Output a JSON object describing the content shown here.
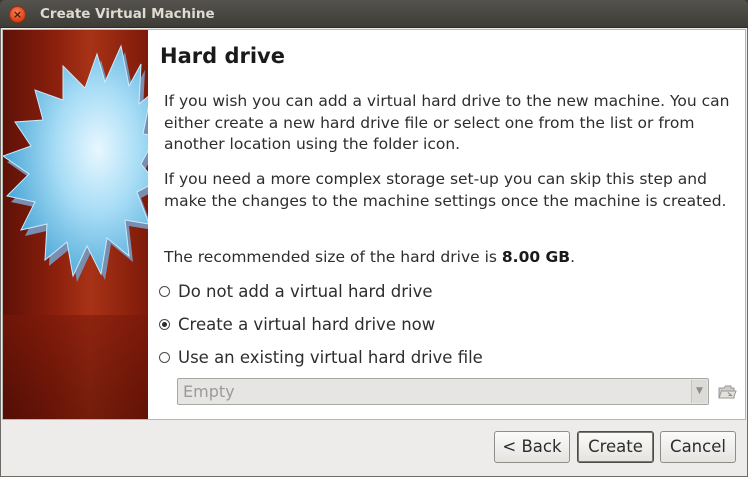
{
  "window": {
    "title": "Create Virtual Machine",
    "close_icon": "close-icon"
  },
  "page": {
    "heading": "Hard drive",
    "paragraph1": "If you wish you can add a virtual hard drive to the new machine. You can either create a new hard drive file or select one from the list or from another location using the folder icon.",
    "paragraph2": "If you need a more complex storage set-up you can skip this step and make the changes to the machine settings once the machine is created.",
    "recommended_prefix": "The recommended size of the hard drive is ",
    "recommended_size": "8.00 GB",
    "recommended_suffix": "."
  },
  "options": [
    {
      "label": "Do not add a virtual hard drive",
      "checked": false
    },
    {
      "label": "Create a virtual hard drive now",
      "checked": true
    },
    {
      "label": "Use an existing virtual hard drive file",
      "checked": false
    }
  ],
  "existing_file": {
    "value": "Empty",
    "enabled": false,
    "folder_icon": "folder-icon"
  },
  "buttons": {
    "back": "< Back",
    "create": "Create",
    "cancel": "Cancel"
  },
  "colors": {
    "titlebar": "#3d3c37",
    "close_button": "#df4a1e",
    "watermark_bg": "#8a1f0c",
    "starburst": "#9fd8f5"
  }
}
